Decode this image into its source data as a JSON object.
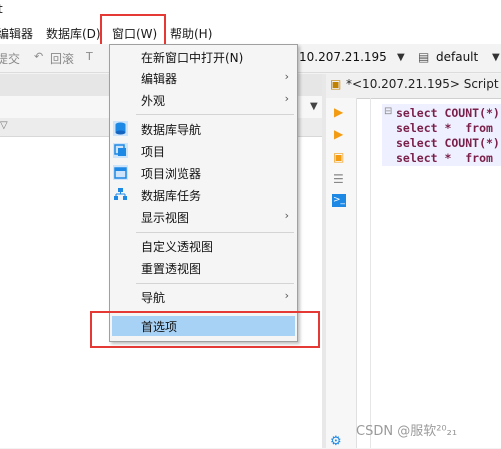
{
  "window": {
    "title_fragment": "t"
  },
  "menubar": {
    "items": [
      "编辑器",
      "数据库(D)",
      "窗口(W)",
      "帮助(H)"
    ]
  },
  "toolbar": {
    "commit_label": "提交",
    "rollback_label": "回滚",
    "host_label": "10.207.21.195",
    "schema_label": "default"
  },
  "editor": {
    "tab_label": "*<10.207.21.195> Script",
    "code_lines": [
      "select COUNT(*)",
      "select *  from",
      "select COUNT(*)",
      "select *  from"
    ]
  },
  "window_menu": {
    "items": [
      {
        "label": "在新窗口中打开(N)",
        "arrow": ""
      },
      {
        "label": "编辑器",
        "arrow": "›"
      },
      {
        "label": "外观",
        "arrow": "›"
      },
      {
        "label": "数据库导航",
        "arrow": ""
      },
      {
        "label": "项目",
        "arrow": ""
      },
      {
        "label": "项目浏览器",
        "arrow": ""
      },
      {
        "label": "数据库任务",
        "arrow": ""
      },
      {
        "label": "显示视图",
        "arrow": "›"
      },
      {
        "label": "自定义透视图",
        "arrow": ""
      },
      {
        "label": "重置透视图",
        "arrow": ""
      },
      {
        "label": "导航",
        "arrow": "›"
      },
      {
        "label": "首选项",
        "arrow": ""
      }
    ]
  },
  "watermark": "CSDN @服软²⁰₂₁",
  "colors": {
    "highlight": "#a8d2f5",
    "annotation_red": "#e53935",
    "icon_blue": "#1e88e5",
    "run_orange": "#f39c12"
  }
}
